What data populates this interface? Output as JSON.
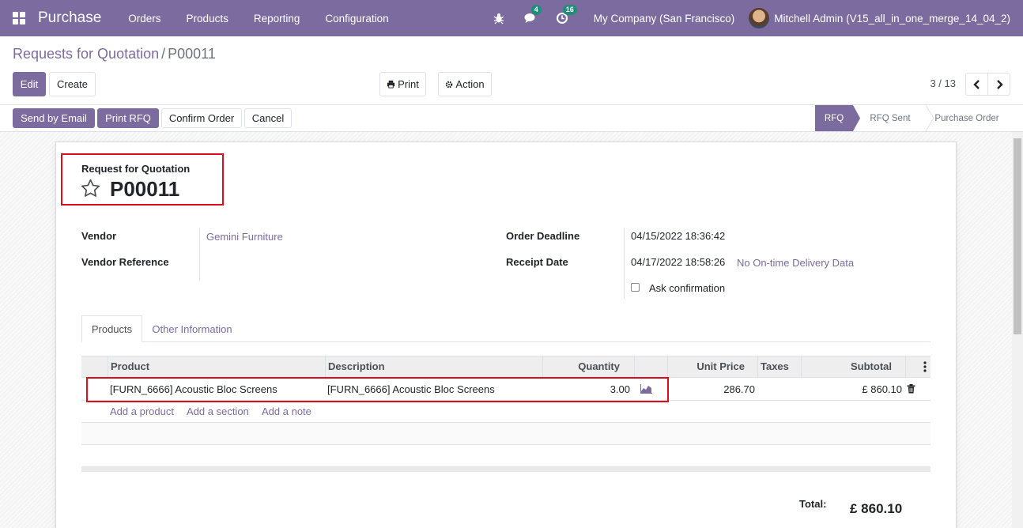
{
  "navbar": {
    "brand": "Purchase",
    "menu": [
      "Orders",
      "Products",
      "Reporting",
      "Configuration"
    ],
    "messages_count": "4",
    "activities_count": "16",
    "company": "My Company (San Francisco)",
    "user": "Mitchell Admin (V15_all_in_one_merge_14_04_2)"
  },
  "breadcrumb": {
    "parent": "Requests for Quotation",
    "separator": "/",
    "current": "P00011"
  },
  "controls": {
    "edit": "Edit",
    "create": "Create",
    "print": "Print",
    "action": "Action",
    "pager": "3 / 13"
  },
  "statusbar": {
    "buttons": [
      "Send by Email",
      "Print RFQ",
      "Confirm Order",
      "Cancel"
    ],
    "stages": [
      "RFQ",
      "RFQ Sent",
      "Purchase Order"
    ],
    "active_stage": "RFQ"
  },
  "form": {
    "doc_type": "Request for Quotation",
    "name": "P00011",
    "vendor_label": "Vendor",
    "vendor": "Gemini Furniture",
    "vendor_ref_label": "Vendor Reference",
    "vendor_ref": "",
    "deadline_label": "Order Deadline",
    "deadline": "04/15/2022 18:36:42",
    "receipt_label": "Receipt Date",
    "receipt": "04/17/2022 18:58:26",
    "ontime": "No On-time Delivery Data",
    "ask_confirmation": "Ask confirmation"
  },
  "tabs": [
    "Products",
    "Other Information"
  ],
  "lines": {
    "columns": [
      "Product",
      "Description",
      "Quantity",
      "Unit Price",
      "Taxes",
      "Subtotal"
    ],
    "rows": [
      {
        "product": "[FURN_6666] Acoustic Bloc Screens",
        "description": "[FURN_6666] Acoustic Bloc Screens",
        "quantity": "3.00",
        "unit_price": "286.70",
        "taxes": "",
        "subtotal": "£ 860.10"
      }
    ],
    "add_product": "Add a product",
    "add_section": "Add a section",
    "add_note": "Add a note"
  },
  "totals": {
    "label": "Total:",
    "value": "£ 860.10"
  },
  "colors": {
    "brand": "#7c6b9e",
    "highlight": "#d9101b",
    "badge": "#1d8e7a"
  }
}
